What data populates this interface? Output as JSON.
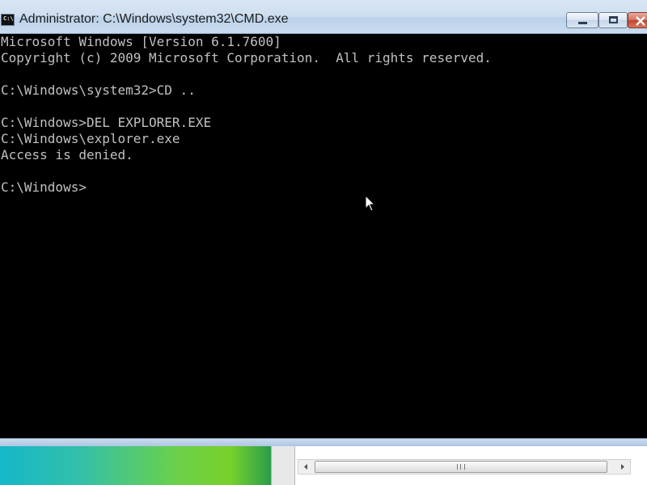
{
  "window": {
    "title": "Administrator: C:\\Windows\\system32\\CMD.exe",
    "icon": "cmd-icon",
    "icon_text": "C:\\"
  },
  "controls": {
    "minimize_icon": "minimize-icon",
    "maximize_icon": "maximize-icon",
    "close_icon": "close-icon"
  },
  "console": {
    "lines": [
      "Microsoft Windows [Version 6.1.7600]",
      "Copyright (c) 2009 Microsoft Corporation.  All rights reserved.",
      "",
      "C:\\Windows\\system32>CD ..",
      "",
      "C:\\Windows>DEL EXPLORER.EXE",
      "C:\\Windows\\explorer.exe",
      "Access is denied.",
      "",
      "C:\\Windows>"
    ]
  },
  "mouse": {
    "icon": "arrow-cursor-icon"
  },
  "scrollbar": {
    "left_icon": "scroll-left-arrow-icon",
    "right_icon": "scroll-right-arrow-icon",
    "grip_icon": "scroll-grip-icon"
  },
  "colors": {
    "console_bg": "#000000",
    "console_text": "#c0c0c0",
    "titlebar": "#cfdff0",
    "close_button": "#c3422a"
  }
}
